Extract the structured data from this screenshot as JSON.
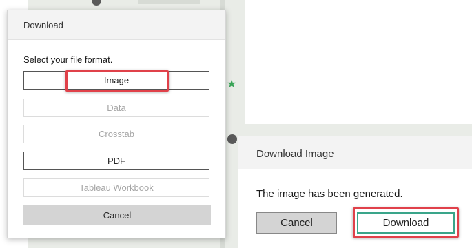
{
  "left_dialog": {
    "title": "Download",
    "prompt": "Select your file format.",
    "formats": [
      {
        "label": "Image",
        "enabled": true
      },
      {
        "label": "Data",
        "enabled": false
      },
      {
        "label": "Crosstab",
        "enabled": false
      },
      {
        "label": "PDF",
        "enabled": true
      },
      {
        "label": "Tableau Workbook",
        "enabled": false
      }
    ],
    "cancel_label": "Cancel"
  },
  "right_dialog": {
    "title": "Download Image",
    "message": "The image has been generated.",
    "cancel_label": "Cancel",
    "download_label": "Download"
  },
  "colors": {
    "highlight": "#e0414a",
    "download_border": "#3aa58a",
    "cancel_bg": "#d4d4d4",
    "header_bg": "#f3f3f3"
  }
}
